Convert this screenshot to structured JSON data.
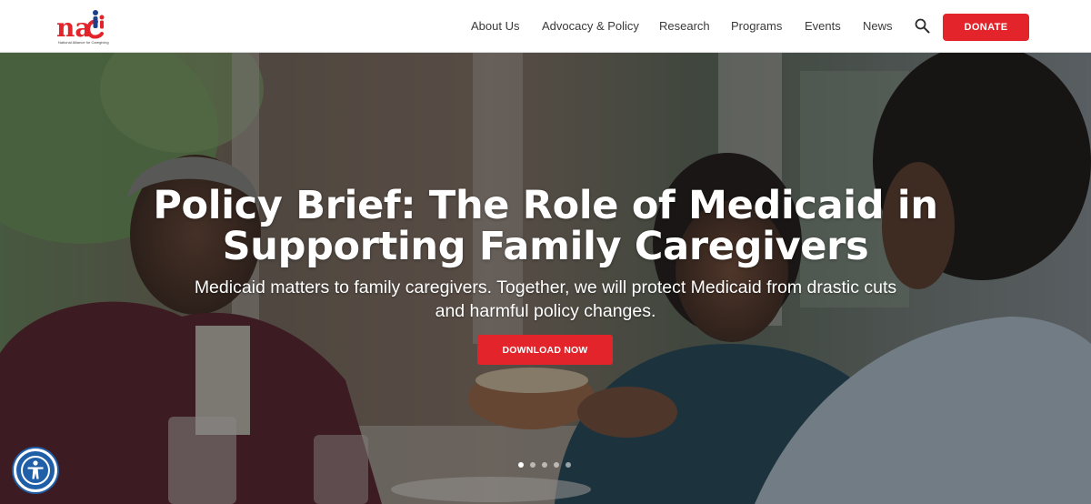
{
  "brand": {
    "logo_text": "nac",
    "tagline": "National Alliance for Caregiving",
    "accent_color": "#e3242b",
    "logo_blue": "#1e3f8a"
  },
  "nav": {
    "items": [
      {
        "label": "About Us"
      },
      {
        "label": "Advocacy & Policy"
      },
      {
        "label": "Research"
      },
      {
        "label": "Programs"
      },
      {
        "label": "Events"
      },
      {
        "label": "News"
      }
    ],
    "search_icon": "search-icon",
    "donate_label": "DONATE"
  },
  "hero": {
    "title_line1": "Policy Brief: The Role of Medicaid in",
    "title_line2": "Supporting Family Caregivers",
    "subtitle_line1": "Medicaid matters to family caregivers. Together, we will protect Medicaid from drastic cuts",
    "subtitle_line2": "and harmful policy changes.",
    "cta_label": "DOWNLOAD NOW",
    "slides_total": 5,
    "active_slide": 1
  },
  "accessibility": {
    "icon": "accessibility-icon"
  }
}
